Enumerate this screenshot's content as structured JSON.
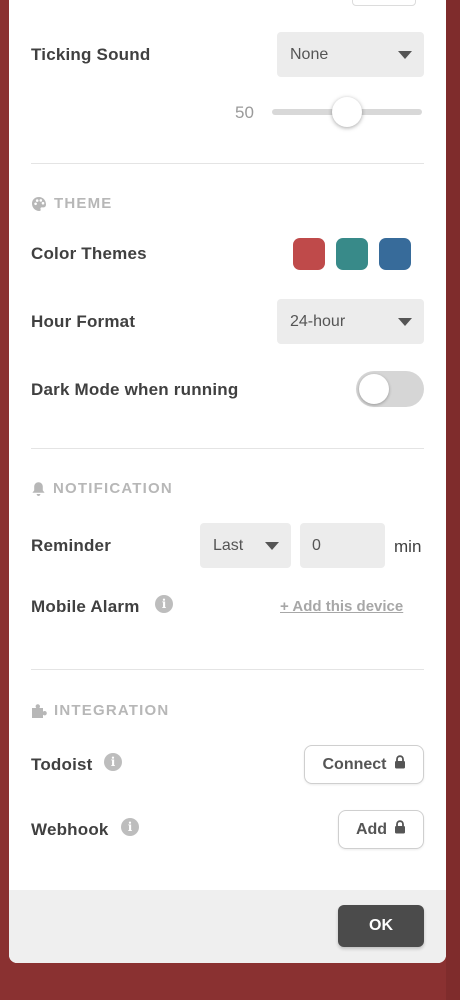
{
  "timer": {
    "ticking_sound_label": "Ticking Sound",
    "ticking_sound_value": "None",
    "ticking_volume": "50",
    "ticking_volume_fraction": 0.5
  },
  "theme": {
    "section_title": "THEME",
    "color_themes_label": "Color Themes",
    "colors": [
      "#bf4a4a",
      "#388a89",
      "#376b9a"
    ],
    "hour_format_label": "Hour Format",
    "hour_format_value": "24-hour",
    "dark_mode_label": "Dark Mode when running",
    "dark_mode_on": false
  },
  "notification": {
    "section_title": "NOTIFICATION",
    "reminder_label": "Reminder",
    "reminder_mode": "Last",
    "reminder_minutes": "0",
    "reminder_unit": "min",
    "mobile_alarm_label": "Mobile Alarm",
    "add_device_link": "+ Add this device"
  },
  "integration": {
    "section_title": "INTEGRATION",
    "todoist_label": "Todoist",
    "todoist_button": "Connect",
    "webhook_label": "Webhook",
    "webhook_button": "Add"
  },
  "footer": {
    "ok_label": "OK"
  },
  "icons": {
    "theme": "palette-icon",
    "notification": "bell-icon",
    "integration": "puzzle-icon",
    "info": "info-icon",
    "lock": "lock-icon"
  }
}
